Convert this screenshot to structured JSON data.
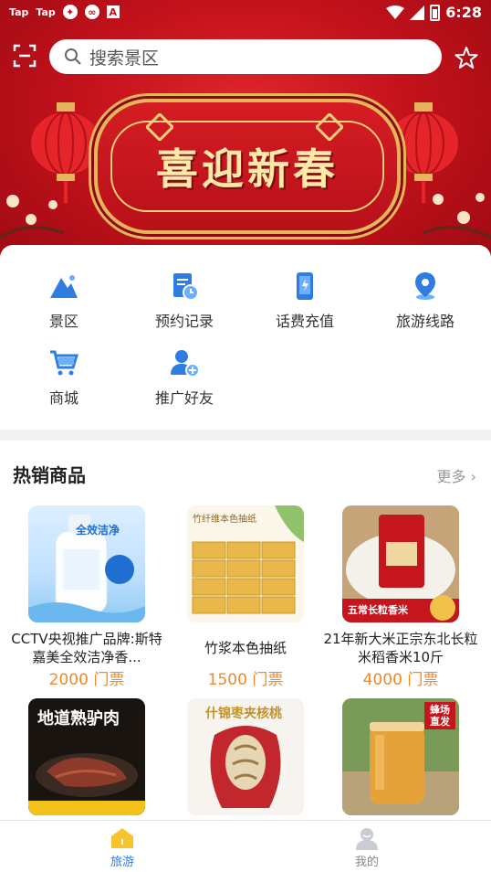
{
  "status_bar": {
    "left_items": [
      "Tap",
      "Tap"
    ],
    "time": "6:28"
  },
  "header": {
    "search_placeholder": "搜索景区",
    "banner_text": "喜迎新春"
  },
  "quick_menu": [
    {
      "label": "景区",
      "icon": "mountain-icon"
    },
    {
      "label": "预约记录",
      "icon": "calendar-clock-icon"
    },
    {
      "label": "话费充值",
      "icon": "phone-charge-icon"
    },
    {
      "label": "旅游线路",
      "icon": "location-pin-icon"
    },
    {
      "label": "商城",
      "icon": "cart-icon"
    },
    {
      "label": "推广好友",
      "icon": "add-user-icon"
    }
  ],
  "hot_products": {
    "title": "热销商品",
    "more_label": "更多 ›",
    "items": [
      {
        "name": "CCTV央视推广品牌:斯特嘉美全效洁净香...",
        "price": "2000 门票",
        "img_text": "全效洁净"
      },
      {
        "name": "竹浆本色抽纸",
        "price": "1500 门票",
        "img_text": "竹纤维本色抽纸"
      },
      {
        "name": "21年新大米正宗东北长粒米稻香米10斤",
        "price": "4000 门票",
        "img_text": "五常长粒香米"
      },
      {
        "name": "",
        "price": "",
        "img_text": "地道熟驴肉"
      },
      {
        "name": "",
        "price": "",
        "img_text": "什锦枣夹核桃"
      },
      {
        "name": "",
        "price": "",
        "img_text": "蜂场直发"
      }
    ]
  },
  "tabbar": {
    "tabs": [
      {
        "label": "旅游"
      },
      {
        "label": "我的"
      }
    ]
  },
  "colors": {
    "brand_red": "#c5121c",
    "price_orange": "#f08a24",
    "icon_blue": "#2f7de1",
    "active_tab": "#2f7de1"
  }
}
